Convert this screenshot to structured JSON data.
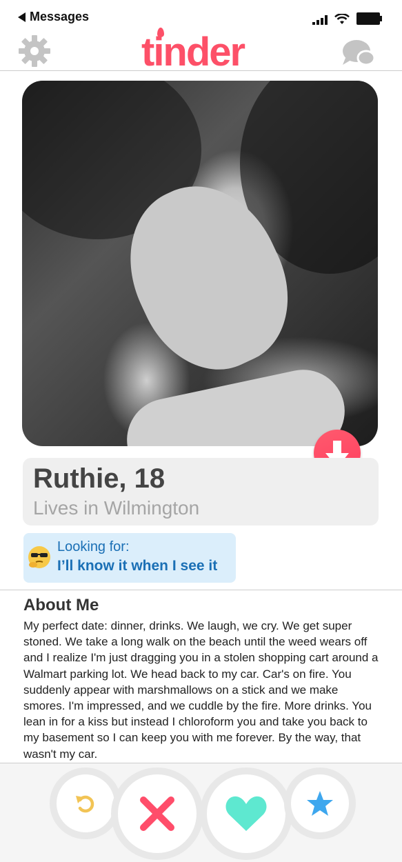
{
  "status_bar": {
    "back_label": "Messages"
  },
  "header": {
    "logo_text": "tinder",
    "brand_color": "#fd5068"
  },
  "profile": {
    "name_age": "Ruthie, 18",
    "location": "Lives in Wilmington",
    "looking_for_label": "Looking for:",
    "looking_for_value": "I’ll know it when I see it"
  },
  "about": {
    "title": "About Me",
    "text": "My perfect date: dinner, drinks. We laugh, we cry. We get super stoned. We take a long walk on the beach until the weed wears off and I realize I'm just dragging you in a stolen shopping cart around a Walmart parking lot. We head back to my car. Car's on fire. You suddenly appear with marshmallows on a stick and we make smores. I'm impressed, and we cuddle by the fire. More drinks. You lean in for a kiss but instead I chloroform you and take you back to my basement so I can keep you with me forever. By the way, that wasn't my car."
  },
  "icons": {
    "settings": "gear-icon",
    "messages": "chat-bubbles-icon",
    "expand": "arrow-down-icon",
    "rewind": "rewind-icon",
    "nope": "x-icon",
    "like": "heart-icon",
    "super_like": "star-icon",
    "emoji": "thinking-sunglasses-emoji"
  },
  "colors": {
    "rewind": "#f2c455",
    "nope": "#ff4d6a",
    "like": "#5ee8d0",
    "super_like": "#3ea7ee",
    "looking_for_text": "#1a6fb5"
  }
}
